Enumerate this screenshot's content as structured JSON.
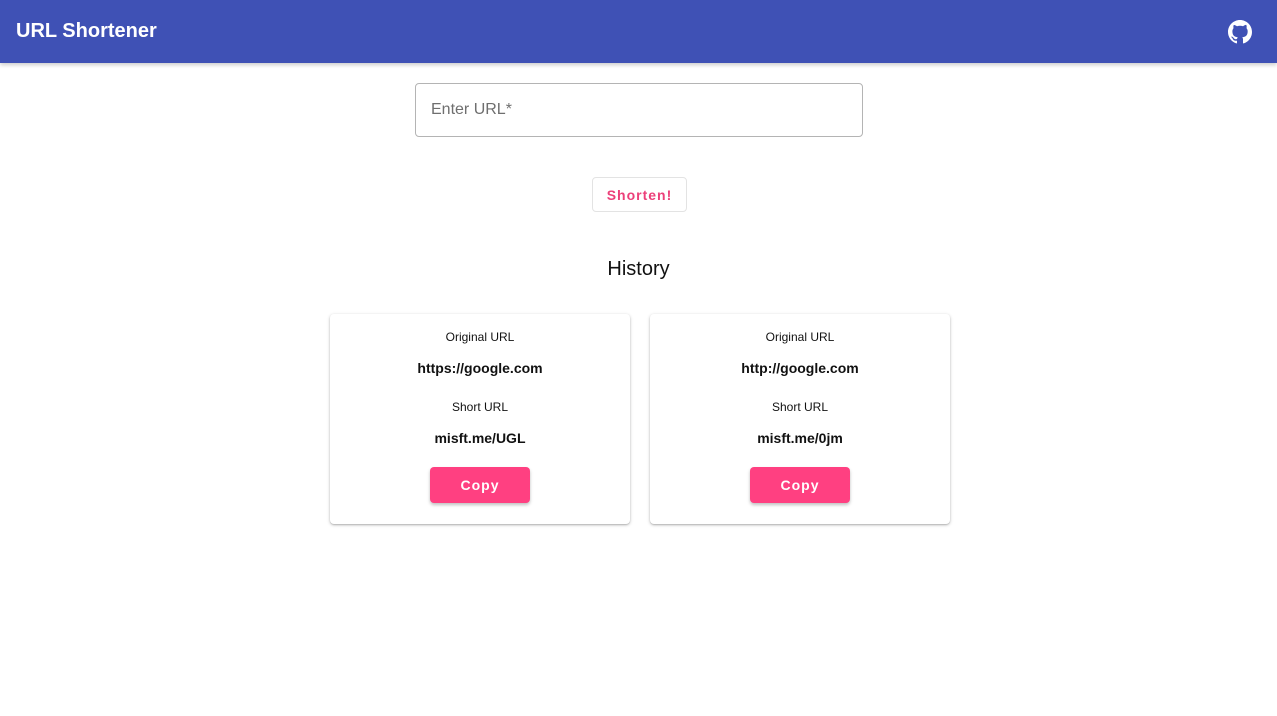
{
  "appbar": {
    "title": "URL Shortener",
    "icon": "github-icon",
    "color": "#3f51b5"
  },
  "form": {
    "url_placeholder": "Enter URL*",
    "url_value": "",
    "shorten_label": "Shorten!"
  },
  "history": {
    "title": "History",
    "cards": [
      {
        "original_label": "Original URL",
        "original_url": "https://google.com",
        "short_label": "Short URL",
        "short_url": "misft.me/UGL",
        "copy_label": "Copy"
      },
      {
        "original_label": "Original URL",
        "original_url": "http://google.com",
        "short_label": "Short URL",
        "short_url": "misft.me/0jm",
        "copy_label": "Copy"
      }
    ]
  },
  "colors": {
    "accent": "#ff4081",
    "accent_text": "#ec407a",
    "primary": "#3f51b5"
  }
}
